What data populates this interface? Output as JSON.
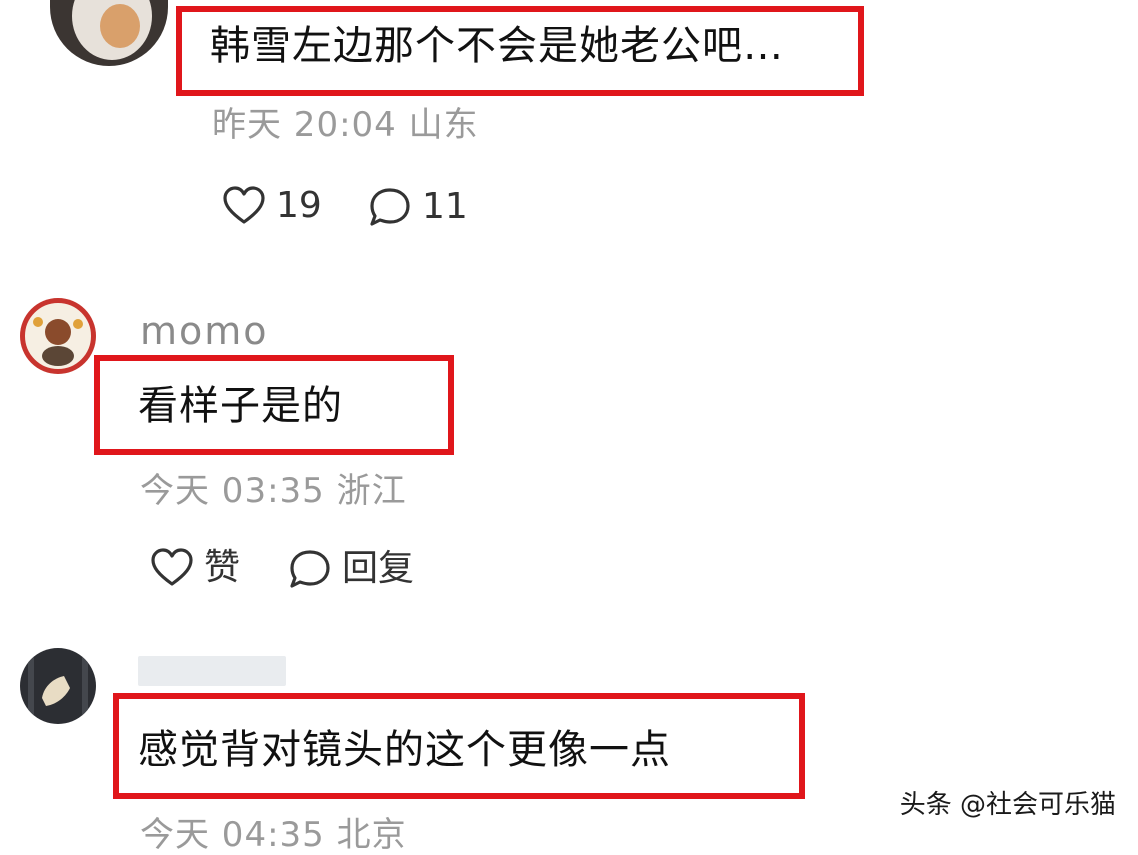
{
  "comments": [
    {
      "username": "",
      "text": "韩雪左边那个不会是她老公吧…",
      "ellipsis": "...",
      "time": "昨天 20:04",
      "location": "山东",
      "likes": "19",
      "replies": "11"
    },
    {
      "username": "momo",
      "text": "看样子是的",
      "time": "今天 03:35",
      "location": "浙江",
      "like_label": "赞",
      "reply_label": "回复"
    },
    {
      "username": "",
      "text": "感觉背对镜头的这个更像一点",
      "time": "今天 04:35",
      "location": "北京"
    }
  ],
  "watermark": "头条 @社会可乐猫",
  "colors": {
    "highlight_border": "#e0161b",
    "meta_text": "#9a9a9a",
    "username_text": "#8a8a8a"
  },
  "icons": {
    "like": "heart-outline-icon",
    "reply": "speech-bubble-icon"
  }
}
